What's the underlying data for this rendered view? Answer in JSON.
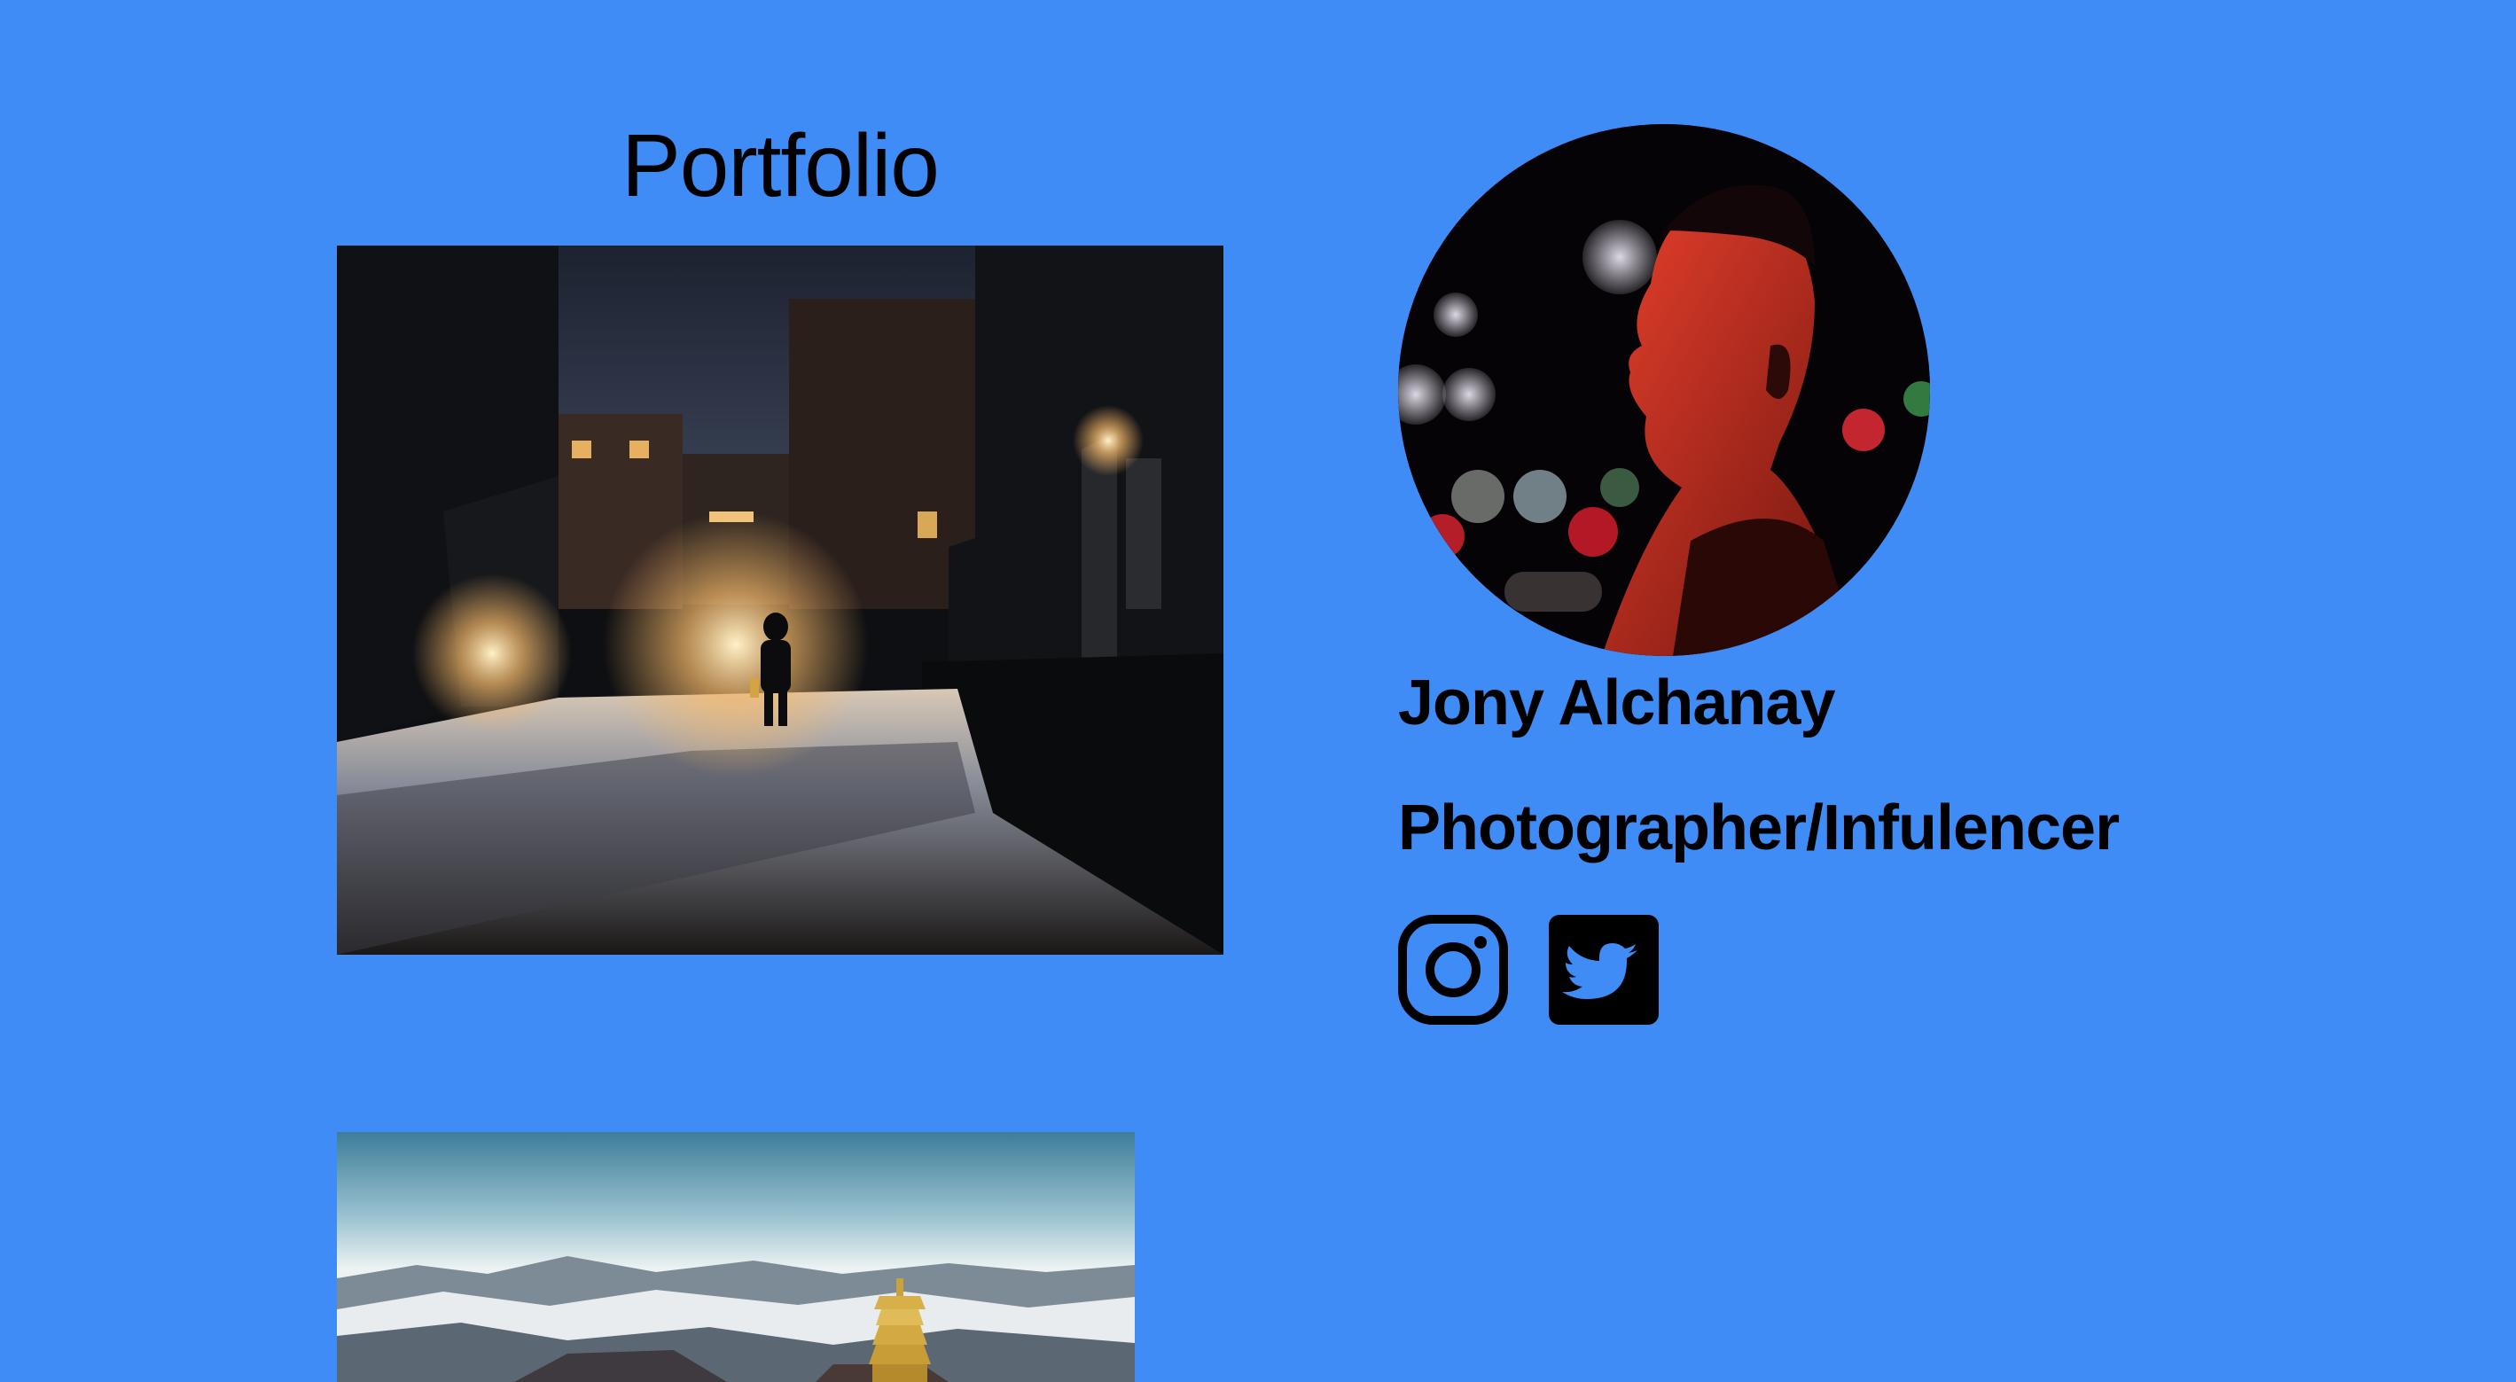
{
  "page": {
    "title": "Portfolio",
    "background_color": "#3f8cf7"
  },
  "portfolio": {
    "photos": [
      {
        "icon": "night-alley-photo"
      },
      {
        "icon": "mountain-pagoda-photo"
      }
    ]
  },
  "profile": {
    "avatar_icon": "portrait-photo",
    "name": "Jony Alchanay",
    "role": "Photographer/Infulencer"
  },
  "social": [
    {
      "icon": "instagram-icon"
    },
    {
      "icon": "twitter-icon"
    }
  ]
}
